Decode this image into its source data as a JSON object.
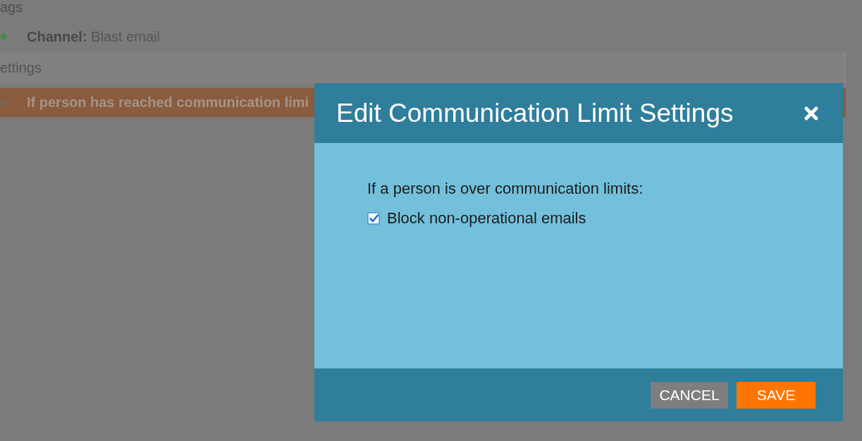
{
  "background_page": {
    "tags_heading": "ags",
    "channel": "**Channel:** Blast email",
    "settings_heading": "ettings",
    "settings_rows": [
      {
        "text": "If person has reached communication limi",
        "selected": true
      }
    ]
  },
  "dialog": {
    "title": "Edit Communication Limit Settings",
    "prompt": "If a person is over communication limits:",
    "options": [
      {
        "label": "Block non-operational emails",
        "checked": true
      }
    ],
    "buttons": [
      {
        "label": "CANCEL",
        "kind": "secondary"
      },
      {
        "label": "SAVE",
        "kind": "primary"
      }
    ]
  }
}
